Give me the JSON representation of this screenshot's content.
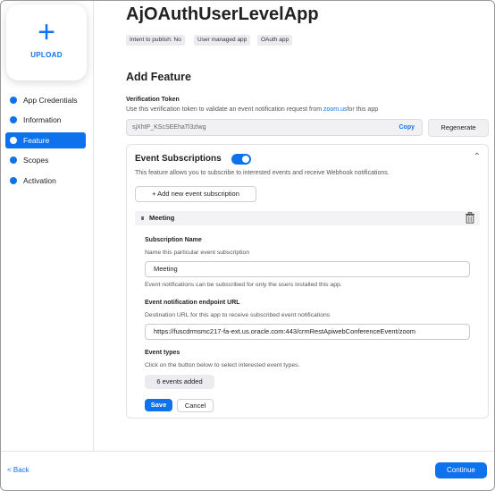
{
  "app": {
    "title": "AjOAuthUserLevelApp",
    "tags": [
      "Intent to publish: No",
      "User managed app",
      "OAuth app"
    ]
  },
  "sidebar": {
    "upload": {
      "icon": "plus-icon",
      "label": "UPLOAD"
    },
    "items": [
      {
        "label": "App Credentials",
        "active": false
      },
      {
        "label": "Information",
        "active": false
      },
      {
        "label": "Feature",
        "active": true
      },
      {
        "label": "Scopes",
        "active": false
      },
      {
        "label": "Activation",
        "active": false
      }
    ]
  },
  "main": {
    "section_title": "Add Feature",
    "verification": {
      "label": "Verification Token",
      "desc_prefix": "Use this verification token to validate an event notification request from ",
      "desc_link": "zoom.us",
      "desc_suffix": "for this app",
      "token": "sjXhtP_KScSEEhaTl3zlwg",
      "copy_label": "Copy",
      "regenerate_label": "Regenerate"
    },
    "event_subscriptions": {
      "title": "Event Subscriptions",
      "enabled": true,
      "description": "This feature allows you to subscribe to interested events and receive Webhook notifications.",
      "add_button": "+ Add new event subscription",
      "subscription": {
        "header": "Meeting",
        "name_label": "Subscription Name",
        "name_desc": "Name this particular event subscription",
        "name_value": "Meeting",
        "name_note": "Event notifications can be subscribed for only the users installed this app.",
        "endpoint_label": "Event notification endpoint URL",
        "endpoint_desc": "Destination URL for this app to receive subscribed event notifications",
        "endpoint_value": "https://fuscdrmsmc217-fa-ext.us.oracle.com:443/crmRestApiwebConferenceEvent/zoom",
        "event_types_label": "Event types",
        "event_types_desc": "Click on the button below to select interested event types.",
        "events_added": "6 events added",
        "save_label": "Save",
        "cancel_label": "Cancel"
      }
    }
  },
  "footer": {
    "back_label": "< Back",
    "continue_label": "Continue"
  },
  "colors": {
    "accent": "#0e72ed",
    "tag_bg": "#ececf0",
    "text": "#222222"
  }
}
